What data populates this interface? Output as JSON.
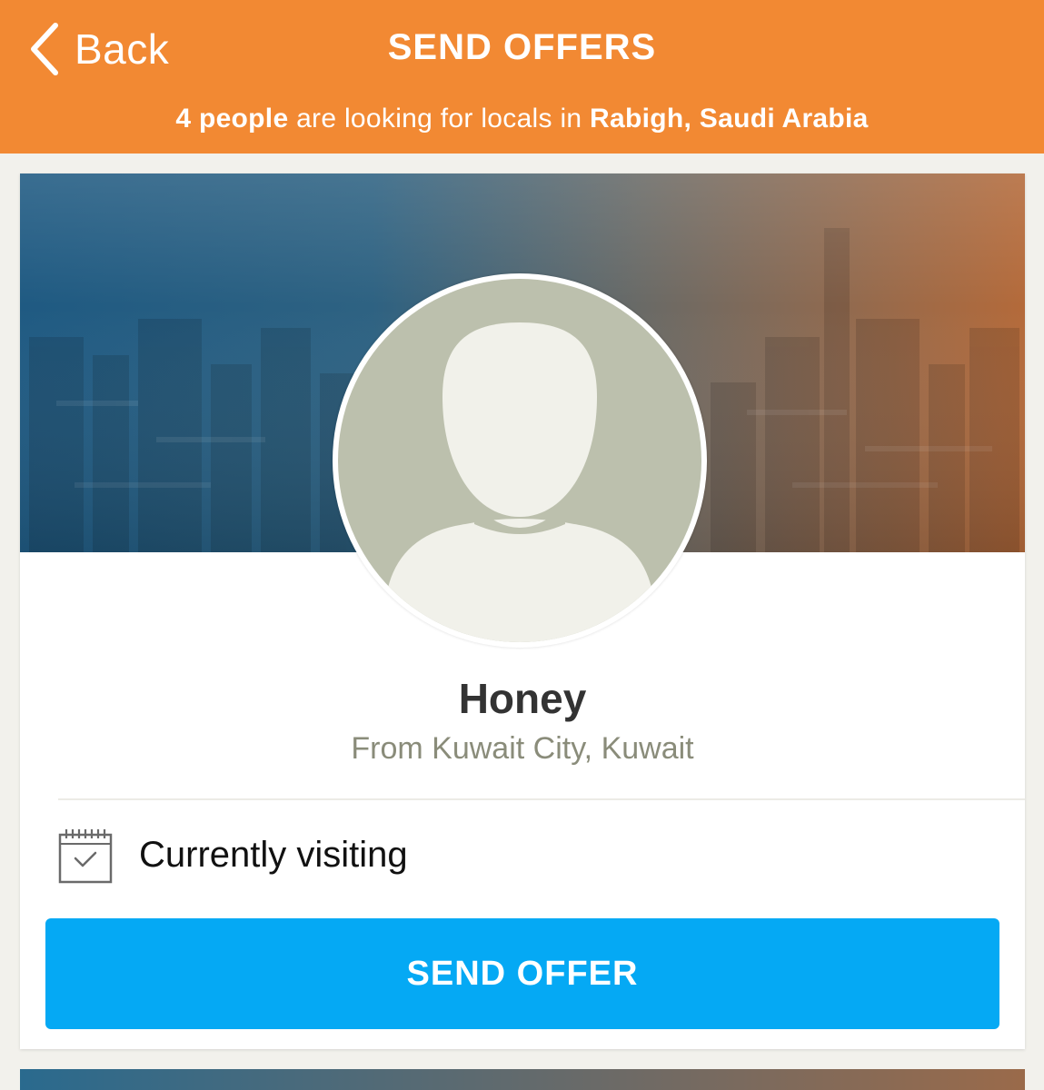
{
  "header": {
    "back_label": "Back",
    "title": "SEND OFFERS",
    "subtitle": {
      "count": "4 people",
      "middle": " are looking for locals in ",
      "location": "Rabigh, Saudi Arabia"
    },
    "color": "#f28933"
  },
  "profile": {
    "name": "Honey",
    "hometown": "From Kuwait City, Kuwait",
    "status_label": "Currently visiting",
    "status_icon": "calendar-check-icon",
    "avatar_icon": "default-avatar-icon"
  },
  "action": {
    "send_offer_label": "SEND OFFER",
    "color": "#05a9f4"
  }
}
